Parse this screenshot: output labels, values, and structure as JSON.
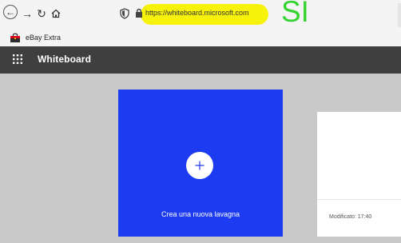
{
  "browser": {
    "url": "https://whiteboard.microsoft.com",
    "annotation": "SI",
    "highlight_color": "#f6f20a",
    "annotation_color": "#34d32f",
    "bookmarks": [
      {
        "label": "eBay Extra",
        "icon": "shopping-bag-icon"
      }
    ]
  },
  "app": {
    "title": "Whiteboard",
    "bar_color": "#3f3f3f",
    "launcher_icon": "app-launcher-icon"
  },
  "main": {
    "new_board": {
      "label": "Crea una nuova lavagna",
      "icon": "plus-icon",
      "color": "#1d3bf0"
    },
    "boards": [
      {
        "modified": "Modificato: 17:40"
      }
    ]
  }
}
